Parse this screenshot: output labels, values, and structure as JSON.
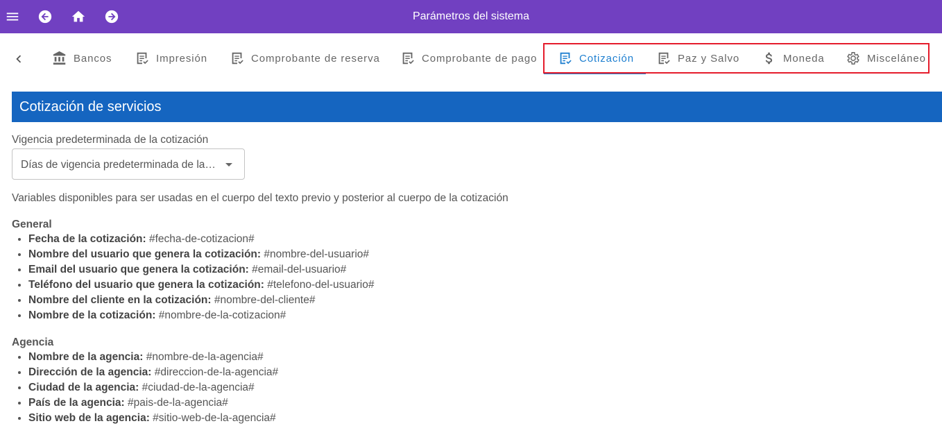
{
  "topbar": {
    "title": "Parámetros del sistema",
    "icons": [
      "menu-icon",
      "arrow-back-icon",
      "home-icon",
      "arrow-forward-icon"
    ],
    "color": "#7140c1"
  },
  "tabs": [
    {
      "label": "Bancos",
      "icon": "bank-icon"
    },
    {
      "label": "Impresión",
      "icon": "document-check-icon"
    },
    {
      "label": "Comprobante de reserva",
      "icon": "document-check-icon"
    },
    {
      "label": "Comprobante de pago",
      "icon": "document-check-icon"
    },
    {
      "label": "Cotización",
      "icon": "document-check-icon",
      "active": true
    },
    {
      "label": "Paz y Salvo",
      "icon": "document-check-icon"
    },
    {
      "label": "Moneda",
      "icon": "dollar-icon"
    },
    {
      "label": "Misceláneo",
      "icon": "gear-icon"
    }
  ],
  "section": {
    "title": "Cotización de servicios",
    "color": "#1565c0"
  },
  "validity": {
    "label": "Vigencia predeterminada de la cotización",
    "select_value": "Días de vigencia predeterminada de la cotización"
  },
  "variables_intro": "Variables disponibles para ser usadas en el cuerpo del texto previo y posterior al cuerpo de la cotización",
  "groups": [
    {
      "title": "General",
      "items": [
        {
          "label": "Fecha de la cotización:",
          "var": "#fecha-de-cotizacion#"
        },
        {
          "label": "Nombre del usuario que genera la cotización:",
          "var": "#nombre-del-usuario#"
        },
        {
          "label": "Email del usuario que genera la cotización:",
          "var": "#email-del-usuario#"
        },
        {
          "label": "Teléfono del usuario que genera la cotización:",
          "var": "#telefono-del-usuario#"
        },
        {
          "label": "Nombre del cliente en la cotización:",
          "var": "#nombre-del-cliente#"
        },
        {
          "label": "Nombre de la cotización:",
          "var": "#nombre-de-la-cotizacion#"
        }
      ]
    },
    {
      "title": "Agencia",
      "items": [
        {
          "label": "Nombre de la agencia:",
          "var": "#nombre-de-la-agencia#"
        },
        {
          "label": "Dirección de la agencia:",
          "var": "#direccion-de-la-agencia#"
        },
        {
          "label": "Ciudad de la agencia:",
          "var": "#ciudad-de-la-agencia#"
        },
        {
          "label": "País de la agencia:",
          "var": "#pais-de-la-agencia#"
        },
        {
          "label": "Sitio web de la agencia:",
          "var": "#sitio-web-de-la-agencia#"
        }
      ]
    }
  ]
}
